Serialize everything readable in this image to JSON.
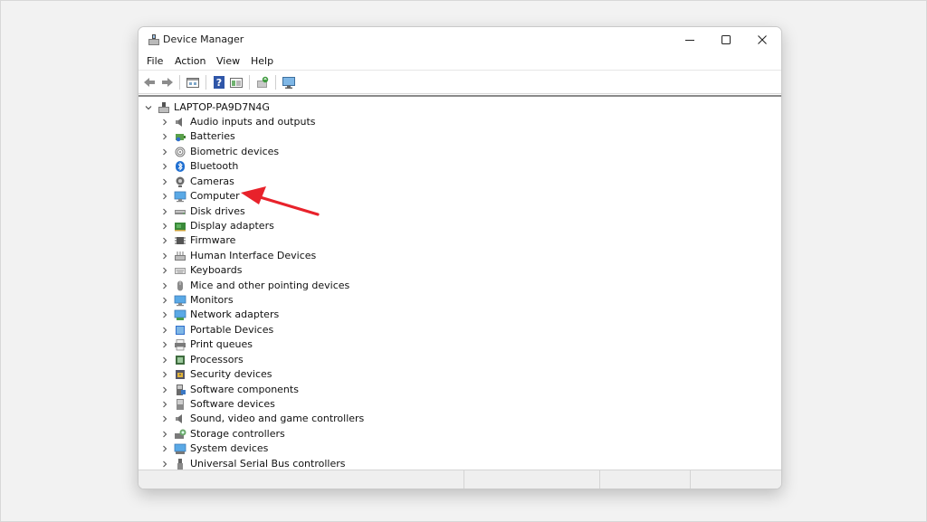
{
  "window": {
    "title": "Device Manager"
  },
  "window_controls": {
    "minimize_icon": "minimize-icon",
    "maximize_icon": "maximize-icon",
    "close_icon": "close-icon"
  },
  "menu": [
    "File",
    "Action",
    "View",
    "Help"
  ],
  "toolbar": {
    "buttons": [
      "back-arrow-icon",
      "forward-arrow-icon",
      "properties-icon",
      "help-icon",
      "show-hide-icon",
      "update-driver-icon",
      "scan-hardware-icon"
    ]
  },
  "tree": {
    "root": "LAPTOP-PA9D7N4G",
    "items": [
      {
        "label": "Audio inputs and outputs",
        "icon": "speaker-icon"
      },
      {
        "label": "Batteries",
        "icon": "battery-icon"
      },
      {
        "label": "Biometric devices",
        "icon": "fingerprint-icon"
      },
      {
        "label": "Bluetooth",
        "icon": "bluetooth-icon"
      },
      {
        "label": "Cameras",
        "icon": "camera-icon"
      },
      {
        "label": "Computer",
        "icon": "monitor-icon"
      },
      {
        "label": "Disk drives",
        "icon": "disk-drive-icon"
      },
      {
        "label": "Display adapters",
        "icon": "display-adapter-icon"
      },
      {
        "label": "Firmware",
        "icon": "chip-icon"
      },
      {
        "label": "Human Interface Devices",
        "icon": "hid-icon"
      },
      {
        "label": "Keyboards",
        "icon": "keyboard-icon"
      },
      {
        "label": "Mice and other pointing devices",
        "icon": "mouse-icon"
      },
      {
        "label": "Monitors",
        "icon": "monitor-icon"
      },
      {
        "label": "Network adapters",
        "icon": "network-icon"
      },
      {
        "label": "Portable Devices",
        "icon": "portable-device-icon"
      },
      {
        "label": "Print queues",
        "icon": "printer-icon"
      },
      {
        "label": "Processors",
        "icon": "processor-icon"
      },
      {
        "label": "Security devices",
        "icon": "security-icon"
      },
      {
        "label": "Software components",
        "icon": "software-component-icon"
      },
      {
        "label": "Software devices",
        "icon": "software-device-icon"
      },
      {
        "label": "Sound, video and game controllers",
        "icon": "speaker-icon"
      },
      {
        "label": "Storage controllers",
        "icon": "storage-icon"
      },
      {
        "label": "System devices",
        "icon": "system-icon"
      },
      {
        "label": "Universal Serial Bus controllers",
        "icon": "usb-icon"
      }
    ]
  },
  "annotation": {
    "type": "red-arrow",
    "points_to": "Computer",
    "color": "#e8222b"
  }
}
